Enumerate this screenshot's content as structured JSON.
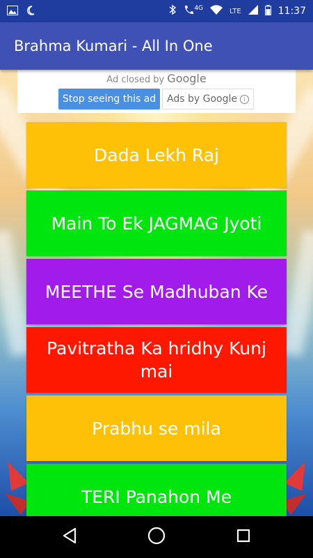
{
  "status_bar": {
    "network": "4G",
    "lte": "LTE",
    "time": "11:37"
  },
  "app_bar": {
    "title": "Brahma Kumari - All In One"
  },
  "ad": {
    "closed_text": "Ad closed by",
    "closed_brand": "Google",
    "stop_button": "Stop seeing this ad",
    "ads_by": "Ads by Google"
  },
  "items": [
    {
      "label": "Dada Lekh Raj",
      "color": "#ffc107"
    },
    {
      "label": "Main To Ek JAGMAG Jyoti",
      "color": "#00e50e"
    },
    {
      "label": "MEETHE Se Madhuban Ke",
      "color": "#a11bea"
    },
    {
      "label": "Pavitratha Ka hridhy Kunj mai",
      "color": "#ff1800"
    },
    {
      "label": "Prabhu se mila",
      "color": "#ffc107"
    },
    {
      "label": "TERI Panahon Me",
      "color": "#00e50e"
    }
  ],
  "colors": {
    "status_bar": "#1f3d9e",
    "app_bar": "#3f51b5",
    "ad_button": "#4a90e2"
  },
  "icons": {
    "status_left": [
      "image-icon",
      "moon-icon"
    ],
    "status_right": [
      "bluetooth-icon",
      "call-icon",
      "wifi-icon",
      "signal-icon",
      "battery-icon"
    ],
    "nav": [
      "back-icon",
      "home-icon",
      "recents-icon"
    ]
  }
}
